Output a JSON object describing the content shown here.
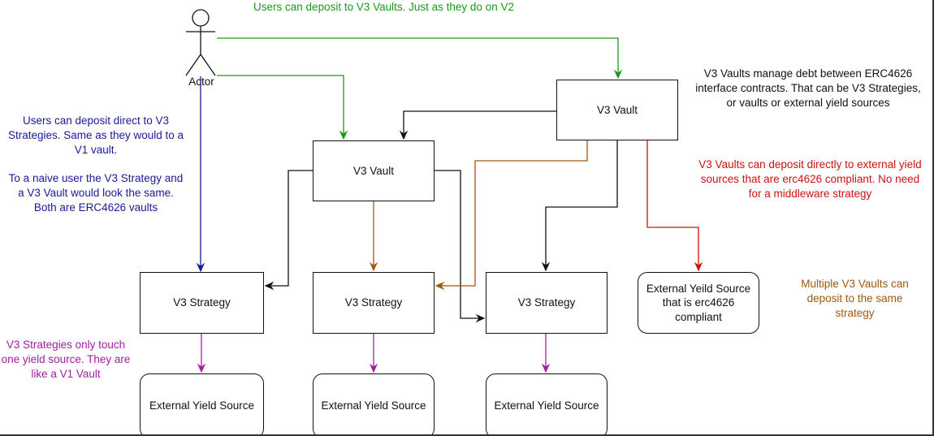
{
  "colors": {
    "green": "#1a9a1a",
    "blue": "#1a1a99",
    "red": "#d01010",
    "brown": "#a0580a",
    "purple": "#a020a0",
    "black": "#111111"
  },
  "actor": {
    "label": "Actor",
    "icon": "stick-figure-icon"
  },
  "nodes": {
    "vault_top": "V3 Vault",
    "vault_middle": "V3 Vault",
    "strategy_1": "V3 Strategy",
    "strategy_2": "V3 Strategy",
    "strategy_3": "V3 Strategy",
    "external_compliant": "External Yeild Source that is erc4626 compliant",
    "external_1": "External Yield Source",
    "external_2": "External Yield Source",
    "external_3": "External Yield Source"
  },
  "notes": {
    "green": "Users can deposit to V3 Vaults. Just as they do on V2",
    "blue": "Users can deposit direct to V3 Strategies. Same as they would to a V1 vault.\n\nTo a naive user the V3 Strategy and a V3 Vault would look the same. Both are ERC4626 vaults",
    "black": "V3 Vaults manage debt between ERC4626 interface contracts. That can be V3 Strategies, or vaults or external yield sources",
    "red": "V3 Vaults can deposit directly to external yield sources that are erc4626 compliant. No need for a middleware strategy",
    "brown": "Multiple V3 Vaults can deposit to the same strategy",
    "purple": "V3 Strategies only touch one yield source. They are like a V1 Vault"
  }
}
